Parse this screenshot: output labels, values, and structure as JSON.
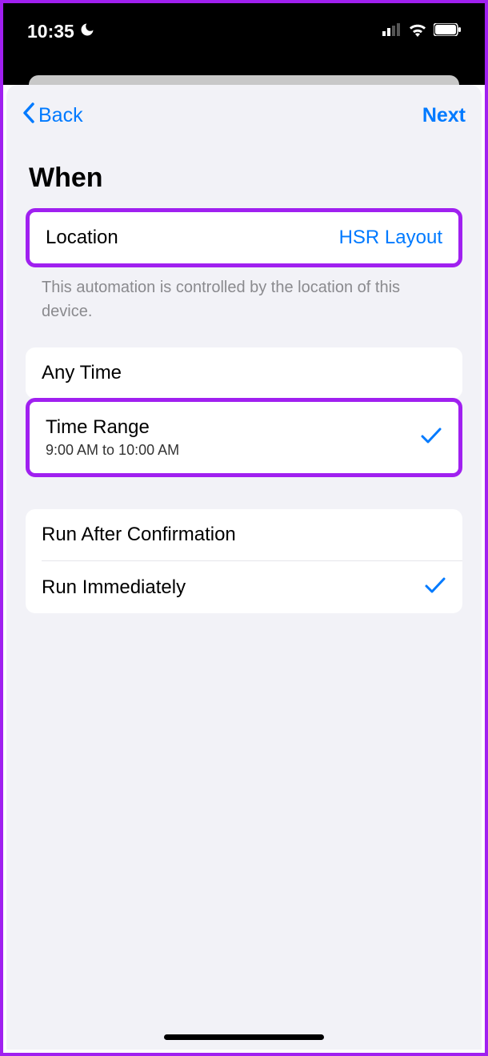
{
  "status": {
    "time": "10:35"
  },
  "nav": {
    "back": "Back",
    "next": "Next"
  },
  "section": {
    "title": "When"
  },
  "location": {
    "label": "Location",
    "value": "HSR Layout",
    "footer": "This automation is controlled by the location of this device."
  },
  "timeOptions": {
    "anyTime": "Any Time",
    "timeRange": "Time Range",
    "timeRangeDetail": "9:00 AM to 10:00 AM"
  },
  "runOptions": {
    "afterConfirmation": "Run After Confirmation",
    "immediately": "Run Immediately"
  }
}
